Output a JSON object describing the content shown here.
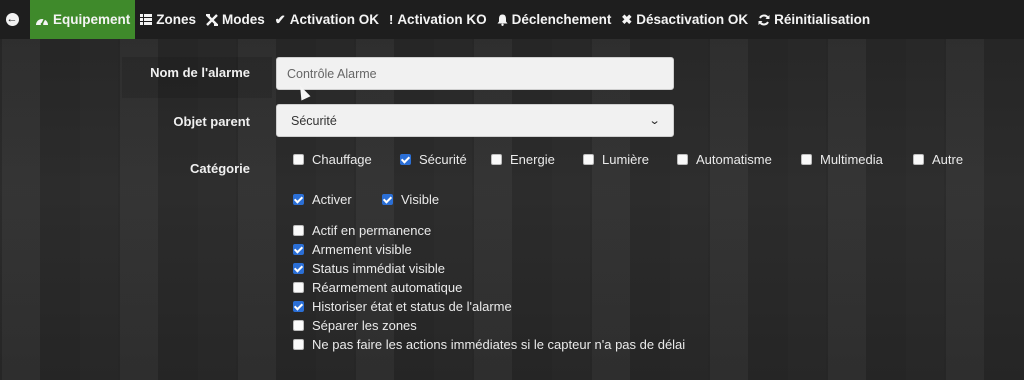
{
  "topbar": {
    "tabs": [
      {
        "label": "Equipement",
        "icon": "dashboard-icon"
      },
      {
        "label": "Zones",
        "icon": "list-icon"
      },
      {
        "label": "Modes",
        "icon": "modes-icon"
      },
      {
        "label": "Activation OK",
        "icon": "check-icon"
      },
      {
        "label": "Activation KO",
        "icon": "exclamation-icon"
      },
      {
        "label": "Déclenchement",
        "icon": "bell-icon"
      },
      {
        "label": "Désactivation OK",
        "icon": "times-icon"
      },
      {
        "label": "Réinitialisation",
        "icon": "refresh-icon"
      }
    ],
    "active_color": "#3f8a2b"
  },
  "form": {
    "alarm_name": {
      "label": "Nom de l'alarme",
      "value": "Contrôle Alarme"
    },
    "parent": {
      "label": "Objet parent",
      "value": "Sécurité"
    },
    "category": {
      "label": "Catégorie",
      "items": [
        {
          "label": "Chauffage",
          "checked": false
        },
        {
          "label": "Sécurité",
          "checked": true
        },
        {
          "label": "Energie",
          "checked": false
        },
        {
          "label": "Lumière",
          "checked": false
        },
        {
          "label": "Automatisme",
          "checked": false
        },
        {
          "label": "Multimedia",
          "checked": false
        },
        {
          "label": "Autre",
          "checked": false
        }
      ]
    },
    "activer": {
      "label": "Activer",
      "checked": true
    },
    "visible": {
      "label": "Visible",
      "checked": true
    },
    "options": [
      {
        "label": "Actif en permanence",
        "checked": false
      },
      {
        "label": "Armement visible",
        "checked": true
      },
      {
        "label": "Status immédiat visible",
        "checked": true
      },
      {
        "label": "Réarmement automatique",
        "checked": false
      },
      {
        "label": "Historiser état et status de l'alarme",
        "checked": true
      },
      {
        "label": "Séparer les zones",
        "checked": false
      },
      {
        "label": "Ne pas faire les actions immédiates si le capteur n'a pas de délai",
        "checked": false
      }
    ],
    "checkbox_color": "#2b6fd6"
  }
}
